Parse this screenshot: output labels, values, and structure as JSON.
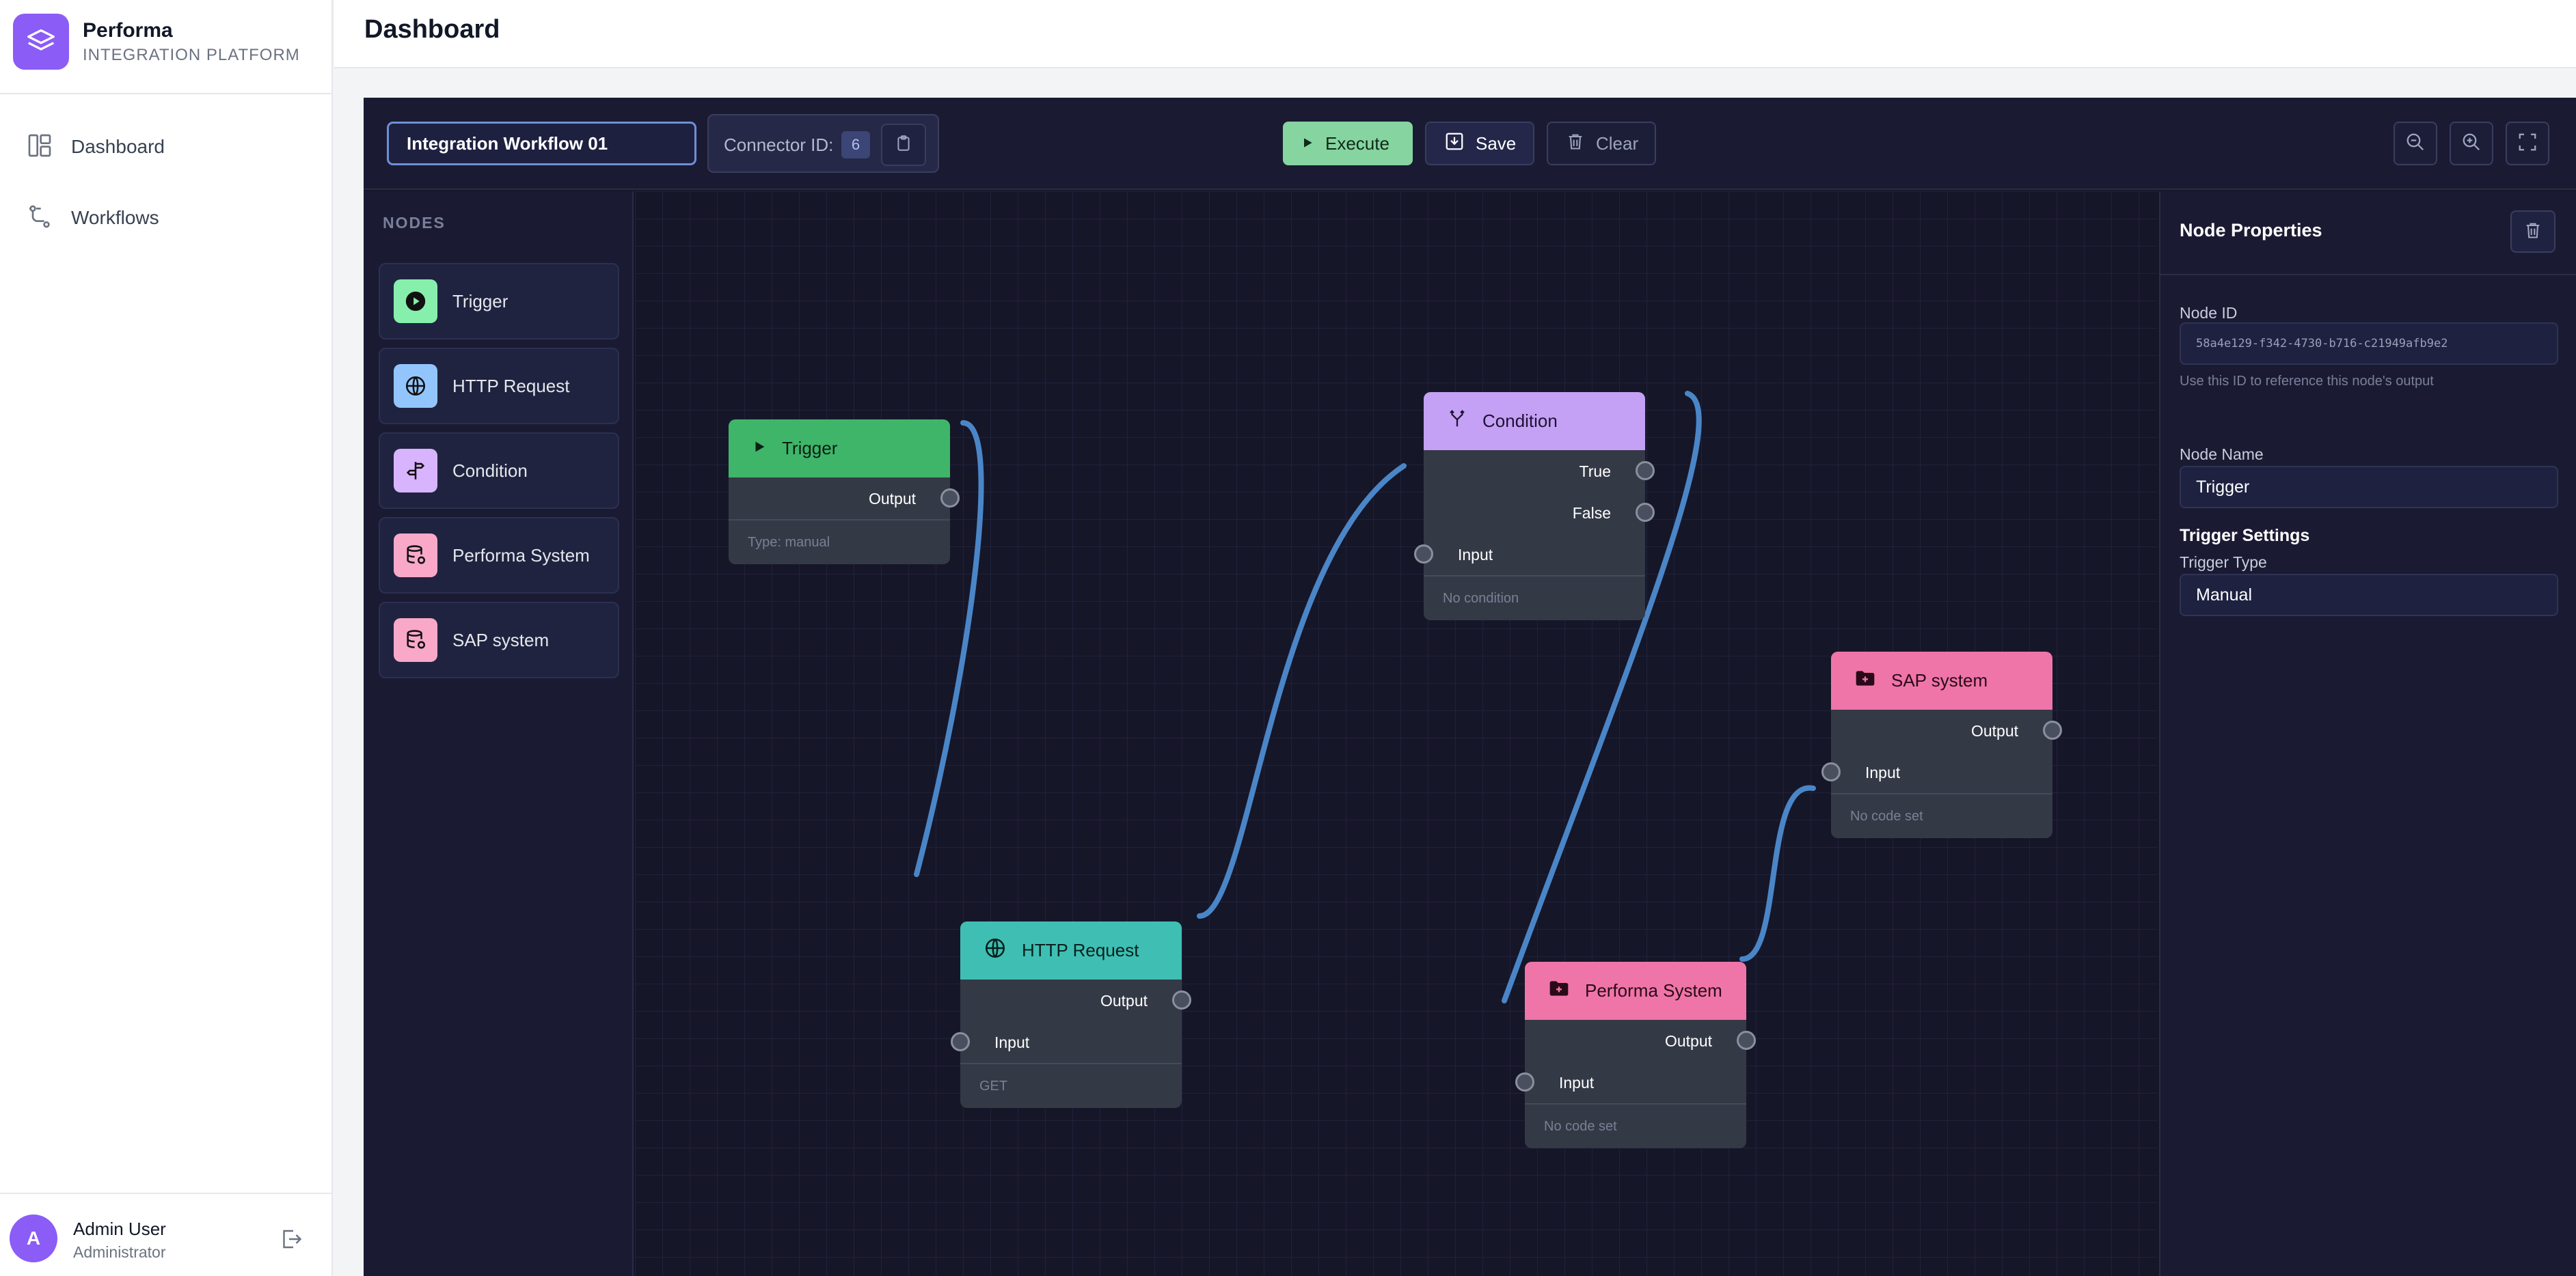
{
  "app": {
    "name": "Performa",
    "subtitle": "INTEGRATION PLATFORM"
  },
  "nav": [
    {
      "label": "Dashboard",
      "icon": "dashboard-icon"
    },
    {
      "label": "Workflows",
      "icon": "workflow-icon"
    }
  ],
  "user": {
    "initial": "A",
    "name": "Admin User",
    "role": "Administrator"
  },
  "page": {
    "title": "Dashboard"
  },
  "toolbar": {
    "workflow_name": "Integration Workflow 01",
    "connector_label": "Connector ID:",
    "connector_id": "6",
    "execute": "Execute",
    "save": "Save",
    "clear": "Clear"
  },
  "palette": {
    "title": "NODES",
    "items": [
      {
        "label": "Trigger",
        "icon": "play-icon",
        "color": "#86efac"
      },
      {
        "label": "HTTP Request",
        "icon": "globe-icon",
        "color": "#93c5fd"
      },
      {
        "label": "Condition",
        "icon": "signpost-icon",
        "color": "#d8b4fe"
      },
      {
        "label": "Performa System",
        "icon": "database-icon",
        "color": "#f9a8c8"
      },
      {
        "label": "SAP system",
        "icon": "database-icon",
        "color": "#f9a8c8"
      }
    ]
  },
  "nodes": {
    "trigger": {
      "title": "Trigger",
      "output": "Output",
      "footer": "Type: manual",
      "color": "#3fb56a"
    },
    "http": {
      "title": "HTTP Request",
      "output": "Output",
      "input": "Input",
      "footer": "GET",
      "color": "#3fbfb3"
    },
    "condition": {
      "title": "Condition",
      "true": "True",
      "false": "False",
      "input": "Input",
      "footer": "No condition",
      "color": "#c4a1f5"
    },
    "performa": {
      "title": "Performa System",
      "output": "Output",
      "input": "Input",
      "footer": "No code set",
      "color": "#ef75a8"
    },
    "sap": {
      "title": "SAP system",
      "output": "Output",
      "input": "Input",
      "footer": "No code set",
      "color": "#ef75a8"
    }
  },
  "properties": {
    "title": "Node Properties",
    "node_id_label": "Node ID",
    "node_id": "58a4e129-f342-4730-b716-c21949afb9e2",
    "node_id_help": "Use this ID to reference this node's output",
    "node_name_label": "Node Name",
    "node_name": "Trigger",
    "section": "Trigger Settings",
    "trigger_type_label": "Trigger Type",
    "trigger_type": "Manual"
  }
}
